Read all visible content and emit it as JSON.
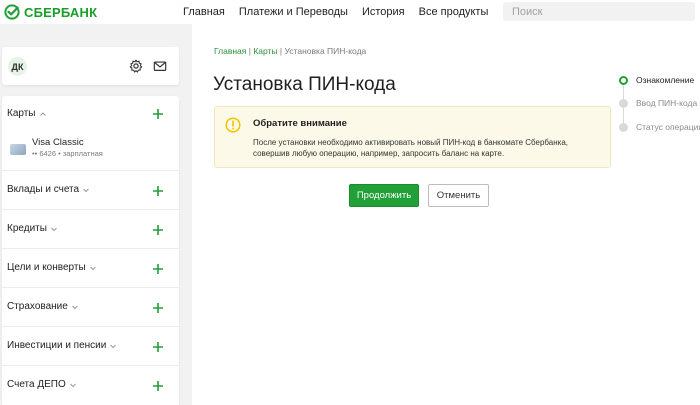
{
  "header": {
    "logo_text": "СБЕРБАНК",
    "nav": [
      "Главная",
      "Платежи и Переводы",
      "История",
      "Все продукты"
    ],
    "search_placeholder": "Поиск"
  },
  "user": {
    "initials": "ДК"
  },
  "sidebar": {
    "sections": [
      {
        "title": "Карты",
        "expanded": true
      },
      {
        "title": "Вклады и счета",
        "expanded": false
      },
      {
        "title": "Кредиты",
        "expanded": false
      },
      {
        "title": "Цели и конверты",
        "expanded": false
      },
      {
        "title": "Страхование",
        "expanded": false
      },
      {
        "title": "Инвестиции и пенсии",
        "expanded": false
      },
      {
        "title": "Счета ДЕПО",
        "expanded": false
      }
    ],
    "card": {
      "name": "Visa Classic",
      "sub": "•• 6426 • зарплатная"
    }
  },
  "breadcrumb": [
    "Главная",
    "Карты",
    "Установка ПИН-кода"
  ],
  "page_title": "Установка ПИН-кода",
  "alert": {
    "title": "Обратите внимание",
    "text": "После установки необходимо активировать новый ПИН-код в банкомате Сбербанка, совершив любую операцию, например, запросить баланс на карте."
  },
  "buttons": {
    "continue": "Продолжить",
    "cancel": "Отменить"
  },
  "steps": [
    {
      "label": "Ознакомление",
      "active": true
    },
    {
      "label": "Ввод ПИН-кода",
      "active": false
    },
    {
      "label": "Статус операции",
      "active": false
    }
  ],
  "colors": {
    "brand_green": "#21a038",
    "alert_bg": "#fdf9e8",
    "alert_icon": "#f2c200"
  }
}
